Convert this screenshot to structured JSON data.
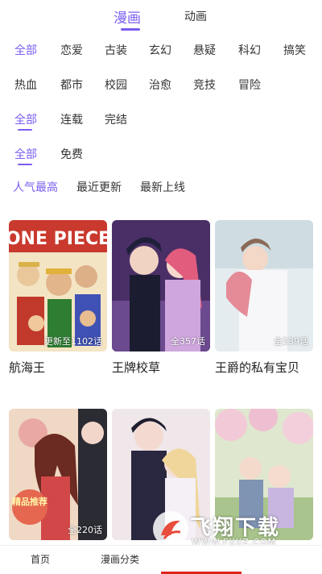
{
  "colors": {
    "accent": "#7b5cf0",
    "nav_indicator": "#e0241b"
  },
  "top_tabs": [
    {
      "label": "漫画",
      "active": true
    },
    {
      "label": "动画",
      "active": false
    }
  ],
  "genre_filters": [
    "全部",
    "恋爱",
    "古装",
    "玄幻",
    "悬疑",
    "科幻",
    "搞笑",
    "热血",
    "都市",
    "校园",
    "治愈",
    "竞技",
    "冒险"
  ],
  "status_filters": [
    "全部",
    "连载",
    "完结"
  ],
  "price_filters": [
    "全部",
    "免费"
  ],
  "sort_options": [
    "人气最高",
    "最近更新",
    "最新上线"
  ],
  "comics": [
    {
      "title": "航海王",
      "episodes": "更新至1102话"
    },
    {
      "title": "王牌校草",
      "episodes": "全357话"
    },
    {
      "title": "王爵的私有宝贝",
      "episodes": "全239话"
    },
    {
      "title": "",
      "episodes": "全220话"
    },
    {
      "title": "",
      "episodes": ""
    },
    {
      "title": "",
      "episodes": ""
    }
  ],
  "bottom_nav": [
    "首页",
    "漫画分类",
    "",
    ""
  ],
  "watermark": {
    "text": "飞翔下载",
    "url": "WWW.FXXZ.COM"
  },
  "badge": {
    "text": "精品推荐"
  }
}
